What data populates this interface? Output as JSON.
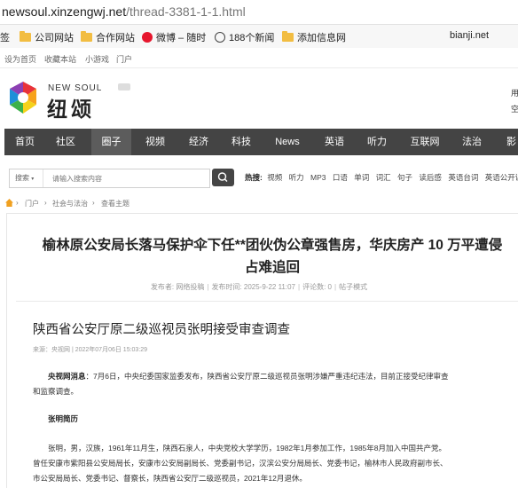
{
  "address": {
    "host": "newsoul.xinzengwj.net",
    "path": "/thread-3381-1-1.html"
  },
  "bookmarks": {
    "cut": "签",
    "items": [
      "公司网站",
      "合作网站",
      "微博 – 随时",
      "188个新闻",
      "添加信息网"
    ],
    "right": "bianji.net"
  },
  "toplinks": [
    "设为首页",
    "收藏本站",
    "小游戏",
    "门户"
  ],
  "brand": {
    "en": "NEW SOUL",
    "cn": "纽颂",
    "right_cut_1": "用",
    "right_cut_2": "空"
  },
  "nav": [
    "首页",
    "社区",
    "圈子",
    "视频",
    "经济",
    "科技",
    "News",
    "英语",
    "听力",
    "互联网",
    "法治",
    "影"
  ],
  "search": {
    "select": "搜索",
    "placeholder": "请输入搜索内容"
  },
  "hot": {
    "label": "热搜:",
    "items": [
      "视频",
      "听力",
      "MP3",
      "口语",
      "单词",
      "词汇",
      "句子",
      "读后感",
      "英语台词",
      "英语公开课"
    ]
  },
  "breadcrumb": [
    "门户",
    "社会与法治",
    "查看主题"
  ],
  "article": {
    "title_line1": "榆林原公安局长落马保护伞下任**团伙伪公章强售房，华庆房产 10 万平遭侵",
    "title_line2": "占难追回",
    "meta": [
      "发布者: 网络投稿",
      "发布时间: 2025-9-22 11:07",
      "评论数: 0",
      "帖子模式"
    ],
    "subtitle": "陕西省公安厅原二级巡视员张明接受审查调查",
    "source": "来源：央视网 | 2022年07月06日 15:03:29",
    "p1_lead": "央视网消息",
    "p1_l1": "：7月6日，中央纪委国家监委发布，陕西省公安厅原二级巡视员张明涉嫌严重违纪违法，目前正接受纪律审查",
    "p1_l2": "和监察调查。",
    "p2": "张明简历",
    "p3_l1": "张明，男，汉族，1961年11月生，陕西石泉人，中央党校大学学历，1982年1月参加工作，1985年8月加入中国共产党。",
    "p3_l2": "曾任安康市紫阳县公安局局长，安康市公安局副局长、党委副书记，汉滨公安分局局长、党委书记，榆林市人民政府副市长、",
    "p3_l3": "市公安局局长、党委书记、督察长，陕西省公安厅二级巡视员，2021年12月退休。"
  },
  "colors": {
    "nav_bg": "#444444",
    "nav_active": "#5c5c5c",
    "folder": "#f2bd42",
    "weibo": "#e6162d"
  }
}
